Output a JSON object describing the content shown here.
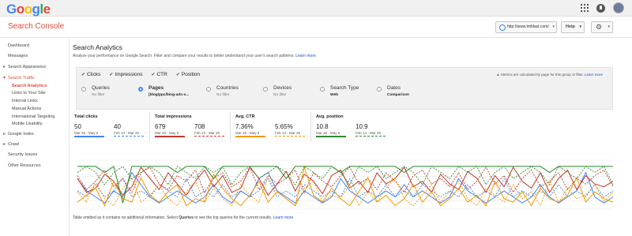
{
  "header": {
    "logo": [
      "G",
      "o",
      "o",
      "g",
      "l",
      "e"
    ],
    "logo_colors": [
      "#4285f4",
      "#ea4335",
      "#fbbc05",
      "#4285f4",
      "#34a853",
      "#ea4335"
    ],
    "product": "Search Console",
    "site": "http://www.tmblast.com/",
    "help": "Help",
    "icons": [
      "apps-grid-icon",
      "notifications-icon",
      "avatar",
      "gear-icon"
    ]
  },
  "sidebar": {
    "items": [
      {
        "label": "Dashboard"
      },
      {
        "label": "Messages"
      },
      {
        "label": "Search Appearance"
      },
      {
        "label": "Search Traffic"
      },
      {
        "label": "Search Analytics"
      },
      {
        "label": "Links to Your Site"
      },
      {
        "label": "Internal Links"
      },
      {
        "label": "Manual Actions"
      },
      {
        "label": "International Targeting"
      },
      {
        "label": "Mobile Usability"
      },
      {
        "label": "Google Index"
      },
      {
        "label": "Crawl"
      },
      {
        "label": "Security Issues"
      },
      {
        "label": "Other Resources"
      }
    ]
  },
  "main": {
    "title": "Search Analytics",
    "desc": "Analyze your performance on Google Search. Filter and compare your results to better understand your user's search patterns.",
    "learn_more": "Learn more.",
    "metrics": [
      "Clicks",
      "Impressions",
      "CTR",
      "Position"
    ],
    "metrics_note": "Metrics are calculated by page for this group or filter.",
    "metrics_note_link": "Learn more",
    "dimensions": [
      {
        "label": "Queries",
        "value": "No filter"
      },
      {
        "label": "Pages",
        "value": "[blog/ppc/bing-ads-s..."
      },
      {
        "label": "Countries",
        "value": "No filter"
      },
      {
        "label": "Devices",
        "value": "No filter"
      },
      {
        "label": "Search Type",
        "value": "Web"
      },
      {
        "label": "Dates",
        "value": "Comparison"
      }
    ],
    "cards": [
      {
        "title": "Total clicks",
        "a": "50",
        "a_range": "Mar 26 - May 5",
        "b": "40",
        "b_range": "Feb 13 - Mar 25"
      },
      {
        "title": "Total impressions",
        "a": "679",
        "a_range": "Mar 26 - May 5",
        "b": "708",
        "b_range": "Feb 13 - Mar 25"
      },
      {
        "title": "Avg. CTR",
        "a": "7.36%",
        "a_range": "Mar 26 - May 5",
        "b": "5.65%",
        "b_range": "Feb 13 - Mar 25"
      },
      {
        "title": "Avg. position",
        "a": "10.8",
        "a_range": "Mar 26 - May 5",
        "b": "10.9",
        "b_range": "Feb 13 - Mar 25"
      }
    ],
    "footnote_pre": "Table omitted as it contains no additional information. Select ",
    "footnote_bold": "Queries",
    "footnote_post": " to see the top queries for the current results.",
    "footnote_link": "Learn more"
  },
  "colors": {
    "clicks": "#4285f4",
    "impressions": "#c0392b",
    "ctr": "#f29900",
    "position": "#2e8b2e"
  },
  "chart_data": {
    "type": "line",
    "series": [
      {
        "values": [
          5,
          3,
          2,
          1,
          3,
          2,
          6,
          4,
          2,
          1,
          2,
          3,
          2,
          1,
          2,
          4,
          2,
          1,
          3,
          2,
          5,
          6,
          3,
          2,
          1,
          3,
          2,
          1,
          2,
          5,
          3,
          2,
          1,
          2,
          3,
          2,
          4,
          2,
          3,
          2,
          1,
          2,
          5,
          3,
          2,
          1,
          2,
          3,
          2,
          1,
          2,
          4,
          2,
          1,
          2,
          3,
          6,
          2,
          1,
          2
        ]
      },
      {
        "values": [
          3,
          2,
          4,
          2,
          3,
          5,
          2,
          3,
          2,
          4,
          3,
          2,
          5,
          2,
          3,
          2,
          4,
          2,
          3,
          2,
          3,
          5,
          2,
          3,
          2,
          4,
          3,
          2,
          3,
          2,
          5,
          2,
          3,
          2,
          4,
          2,
          3,
          2,
          4,
          3,
          2,
          3,
          2,
          4,
          2,
          3,
          2,
          5,
          2,
          3,
          2,
          3,
          2,
          4,
          2,
          3,
          2,
          4,
          2,
          3
        ]
      },
      {
        "values": [
          22,
          12,
          15,
          25,
          20,
          10,
          16,
          30,
          22,
          14,
          26,
          18,
          10,
          20,
          28,
          16,
          24,
          12,
          15,
          30,
          22,
          10,
          18,
          27,
          13,
          25,
          20,
          11,
          24,
          28,
          15,
          20,
          12,
          26,
          18,
          22,
          30,
          16,
          20,
          12,
          25,
          18,
          14,
          27,
          22,
          12,
          24,
          16,
          30,
          20,
          15,
          26,
          12,
          22,
          28,
          14,
          24,
          18,
          16,
          20
        ]
      },
      {
        "values": [
          24,
          14,
          20,
          28,
          16,
          22,
          12,
          26,
          30,
          18,
          14,
          24,
          20,
          28,
          12,
          22,
          26,
          16,
          20,
          30,
          14,
          24,
          18,
          22,
          28,
          12,
          26,
          20,
          16,
          24,
          30,
          18,
          22,
          14,
          26,
          20,
          12,
          24,
          28,
          18,
          22,
          16,
          26,
          14,
          20,
          30,
          18,
          24,
          12,
          22,
          28,
          16,
          20,
          26,
          14,
          22,
          18,
          24,
          28,
          16
        ]
      },
      {
        "values": [
          2,
          4,
          6,
          1,
          8,
          3,
          2,
          9,
          4,
          2,
          5,
          7,
          1,
          3,
          2,
          10,
          6,
          3,
          1,
          4,
          8,
          2,
          5,
          3,
          1,
          12,
          4,
          2,
          6,
          3,
          1,
          5,
          9,
          2,
          4,
          1,
          3,
          7,
          2,
          5,
          1,
          3,
          6,
          2,
          4,
          1,
          8,
          3,
          2,
          5,
          1,
          6,
          3,
          2,
          4,
          9,
          2,
          5,
          3,
          2
        ]
      },
      {
        "values": [
          5,
          2,
          8,
          3,
          1,
          6,
          9,
          2,
          4,
          7,
          3,
          1,
          5,
          8,
          2,
          6,
          3,
          1,
          7,
          4,
          2,
          9,
          5,
          3,
          1,
          6,
          8,
          2,
          4,
          3,
          7,
          1,
          5,
          2,
          6,
          9,
          3,
          1,
          4,
          7,
          2,
          5,
          8,
          3,
          1,
          6,
          4,
          2,
          7,
          3,
          5,
          1,
          8,
          2,
          6,
          3,
          4,
          7,
          2,
          5
        ]
      },
      {
        "values": [
          11,
          11,
          11,
          10,
          11,
          5,
          11,
          11,
          11,
          11,
          11,
          10,
          11,
          11,
          11,
          9,
          11,
          11,
          11,
          11,
          11,
          11,
          11,
          9,
          11,
          11,
          11,
          11,
          11,
          10,
          11,
          11,
          11,
          11,
          11,
          11,
          10,
          11,
          11,
          11,
          11,
          11,
          11,
          11,
          11,
          11,
          11,
          11,
          11,
          11,
          11,
          11,
          10,
          11,
          11,
          11,
          11,
          11,
          11,
          11
        ]
      },
      {
        "values": [
          10,
          11,
          10,
          8,
          10,
          11,
          9,
          10,
          11,
          10,
          8,
          11,
          10,
          9,
          11,
          10,
          11,
          8,
          10,
          11,
          9,
          10,
          11,
          10,
          8,
          11,
          10,
          9,
          11,
          10,
          8,
          11,
          10,
          11,
          9,
          10,
          11,
          10,
          8,
          11,
          10,
          9,
          11,
          10,
          11,
          8,
          10,
          11,
          9,
          10,
          11,
          10,
          8,
          11,
          10,
          9,
          11,
          10,
          11,
          8
        ]
      }
    ]
  }
}
